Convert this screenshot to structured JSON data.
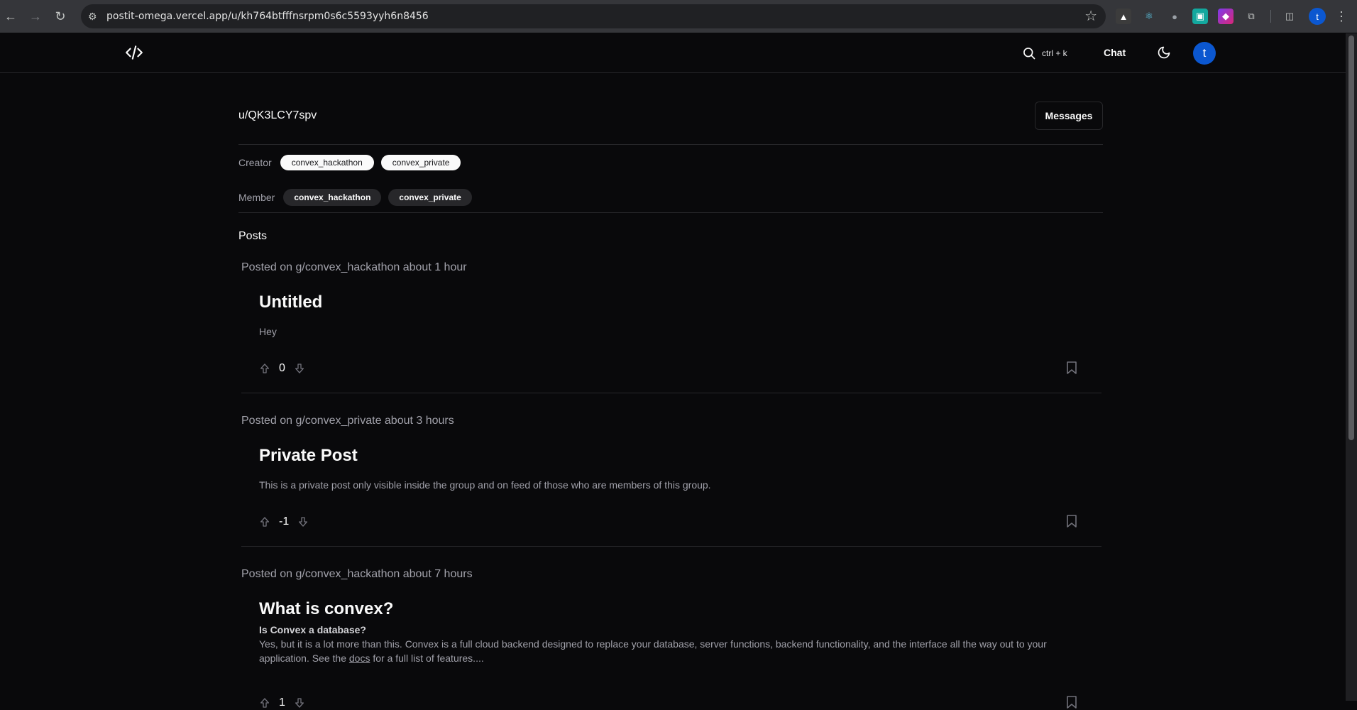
{
  "browser": {
    "url": "postit-omega.vercel.app/u/kh764btfffnsrpm0s6c5593yyh6n8456",
    "profile_initial": "t"
  },
  "header": {
    "search_shortcut": "ctrl + k",
    "chat_label": "Chat",
    "avatar_initial": "t"
  },
  "profile": {
    "username": "u/QK3LCY7spv",
    "messages_label": "Messages",
    "creator_label": "Creator",
    "creator_groups": [
      "convex_hackathon",
      "convex_private"
    ],
    "member_label": "Member",
    "member_groups": [
      "convex_hackathon",
      "convex_private"
    ]
  },
  "posts_heading": "Posts",
  "posts": [
    {
      "meta": "Posted on g/convex_hackathon about 1 hour",
      "title": "Untitled",
      "body": "Hey",
      "votes": "0"
    },
    {
      "meta": "Posted on g/convex_private about 3 hours",
      "title": "Private Post",
      "body": "This is a private post only visible inside the group and on feed of those who are members of this group.",
      "votes": "-1"
    },
    {
      "meta": "Posted on g/convex_hackathon about 7 hours",
      "title": "What is convex?",
      "subtitle": "Is Convex a database?",
      "body_before_link": "Yes, but it is a lot more than this. Convex is a full cloud backend designed to replace your database, server functions, backend functionality, and the interface all the way out to your application. See the ",
      "link_text": "docs",
      "body_after_link": " for a full list of features....",
      "votes": "1"
    }
  ],
  "colors": {
    "background": "#09090b",
    "border": "#27272a",
    "muted_text": "#a1a1aa",
    "avatar": "#0b57d0"
  }
}
